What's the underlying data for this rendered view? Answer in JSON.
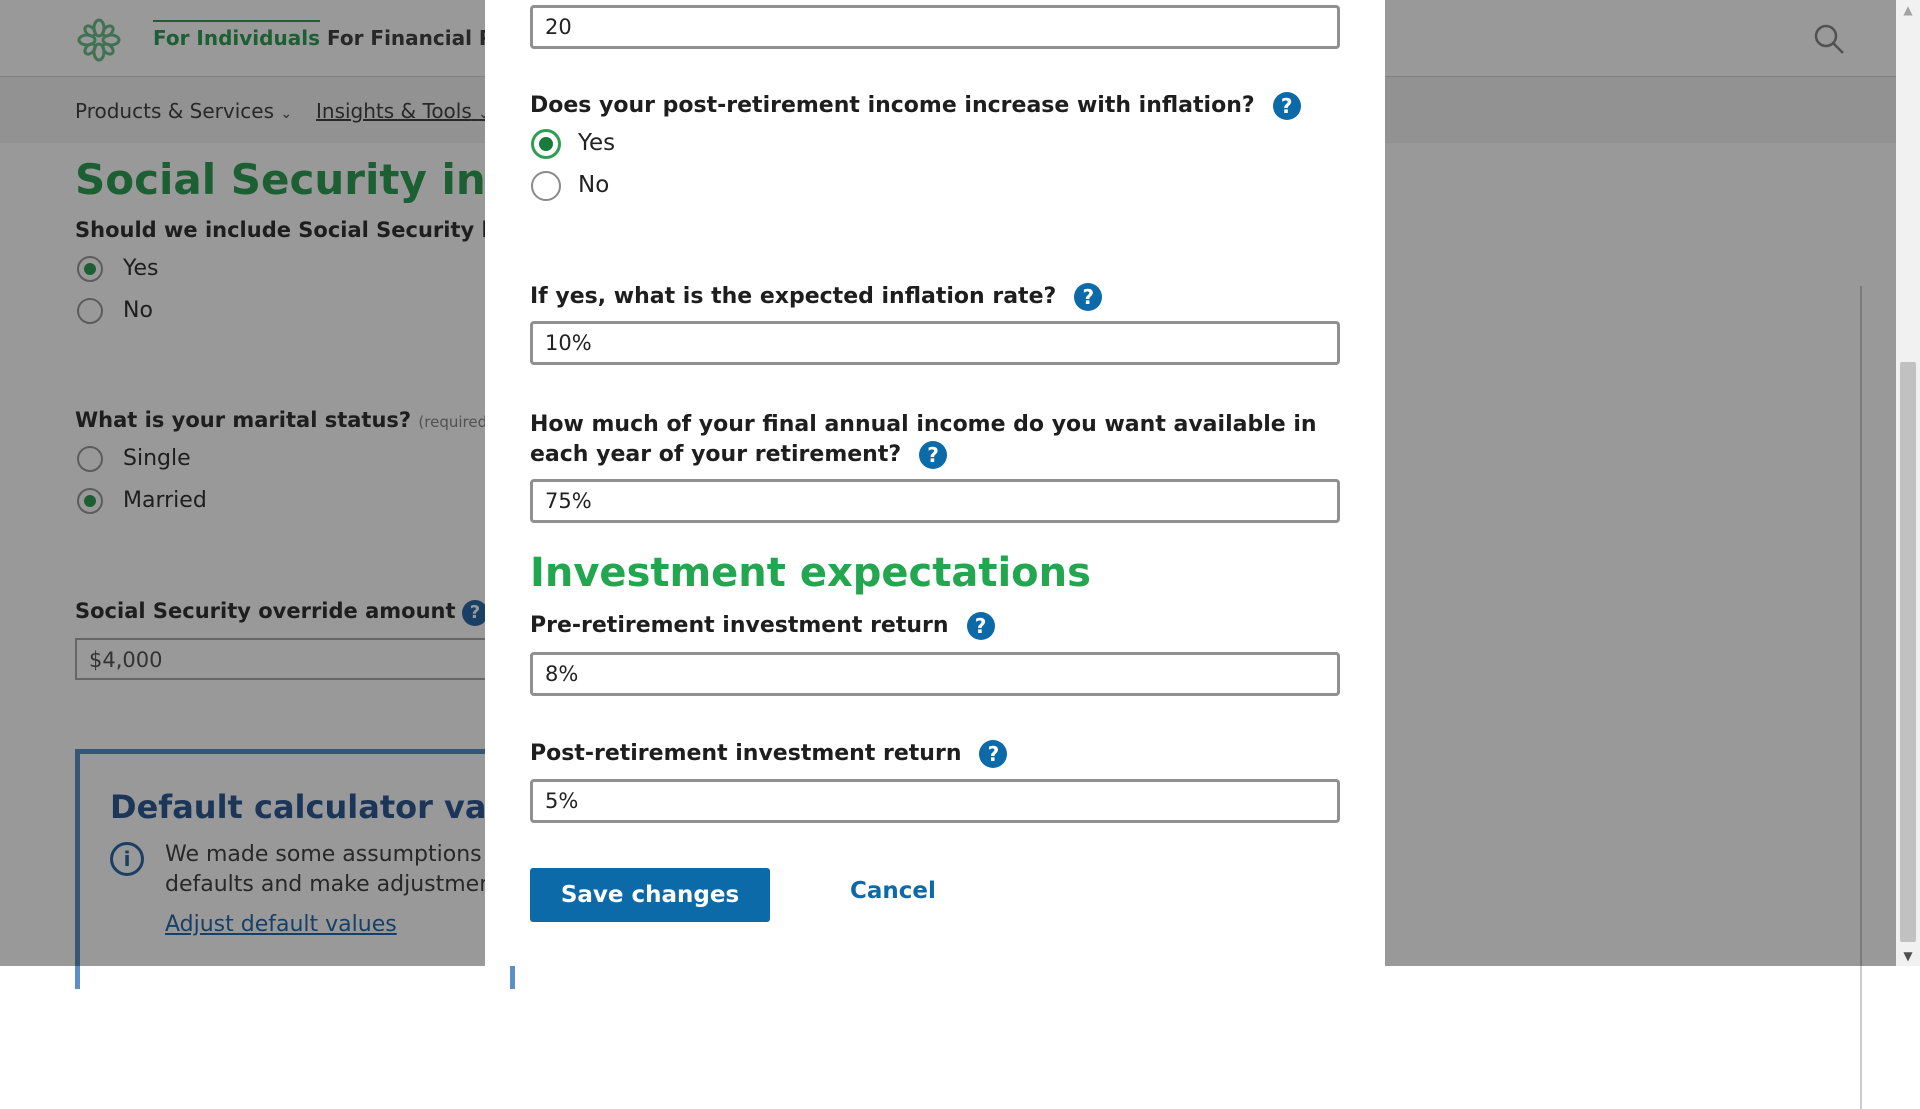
{
  "header": {
    "logo_icon": "flower-logo-icon",
    "nav": [
      {
        "label": "For Individuals",
        "active": true
      },
      {
        "label": "For Financial Pro"
      }
    ],
    "search_icon": "search-icon"
  },
  "subnav": {
    "items": [
      {
        "label": "Products & Services"
      },
      {
        "label": "Insights & Tools"
      }
    ]
  },
  "background": {
    "section_title": "Social Security incor",
    "ss_question": "Should we include Social Security be",
    "ss_options": [
      "Yes",
      "No"
    ],
    "marital_question": "What is your marital status?",
    "marital_required": "(required)",
    "marital_options": [
      "Single",
      "Married"
    ],
    "override_label": "Social Security override amount",
    "override_value": "$4,000",
    "box_title": "Default calculator valu",
    "box_text_1": "We made some assumptions",
    "box_text_2": "defaults and make adjustmen",
    "box_link": "Adjust default values"
  },
  "modal": {
    "years_value": "20",
    "inflation_question": "Does your post-retirement income increase with inflation?",
    "inflation_options": [
      "Yes",
      "No"
    ],
    "inflation_rate_label": "If yes, what is the expected inflation rate?",
    "inflation_rate_value": "10%",
    "income_label": "How much of your final annual income do you want available in each year of your retirement?",
    "income_value": "75%",
    "section_title": "Investment expectations",
    "pre_label": "Pre-retirement investment return",
    "pre_value": "8%",
    "post_label": "Post-retirement investment return",
    "post_value": "5%",
    "help_glyph": "?",
    "save_label": "Save changes",
    "cancel_label": "Cancel"
  },
  "colors": {
    "brand_green": "#22a64f",
    "button_blue": "#0d6aa8",
    "radio_selected": "#1a7a3e"
  }
}
